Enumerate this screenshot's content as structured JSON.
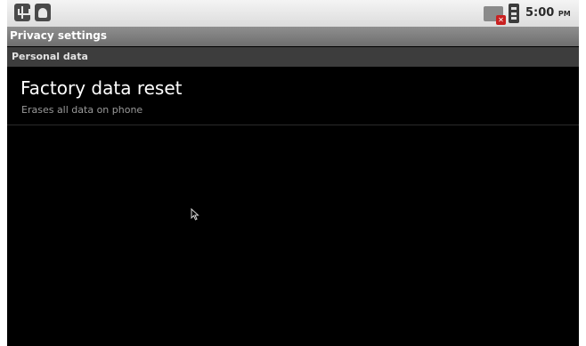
{
  "status_bar": {
    "time": "5:00",
    "ampm": "PM",
    "icons": [
      "usb-icon",
      "debug-icon",
      "no-sim-icon",
      "battery-icon"
    ]
  },
  "title_bar": {
    "title": "Privacy settings"
  },
  "sections": [
    {
      "header": "Personal data",
      "items": [
        {
          "title": "Factory data reset",
          "summary": "Erases all data on phone"
        }
      ]
    }
  ],
  "colors": {
    "background": "#000000",
    "title_bar": "#7f7f7f",
    "category_header": "#3d3d3d",
    "summary_text": "#9a9a9a"
  }
}
